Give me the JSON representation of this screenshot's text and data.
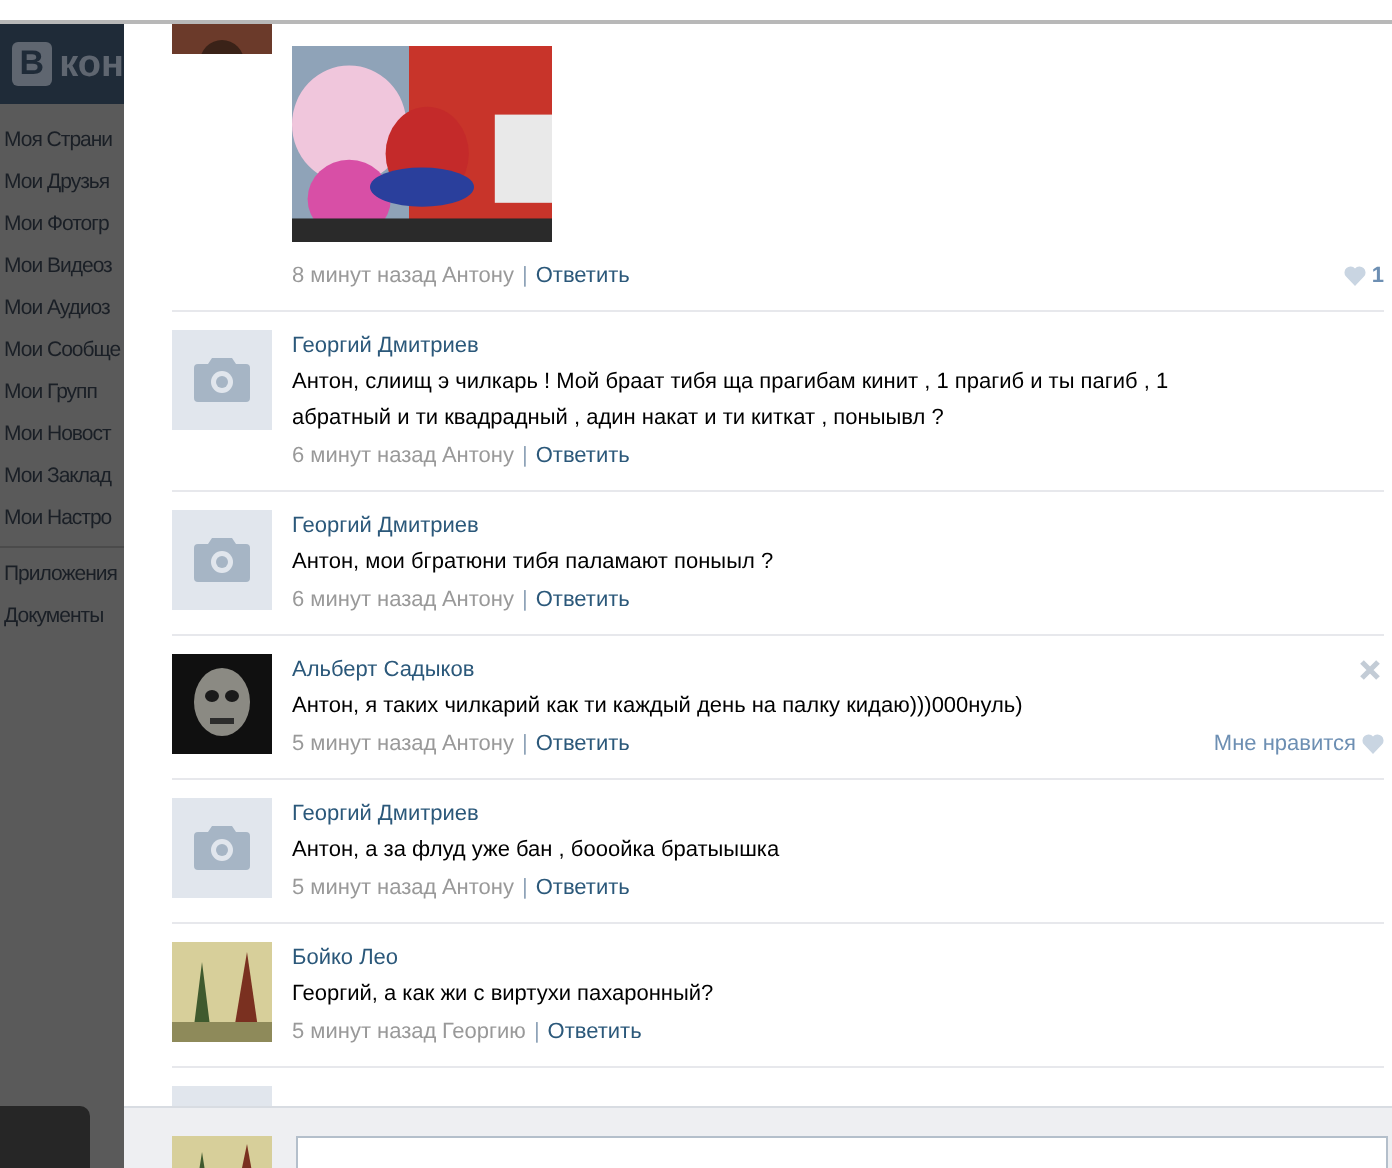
{
  "sidebar": {
    "logo_letter": "В",
    "logo_text": "кон",
    "items": [
      {
        "label": "Моя Страни"
      },
      {
        "label": "Мои Друзья"
      },
      {
        "label": "Мои Фотогр"
      },
      {
        "label": "Мои Видеоз"
      },
      {
        "label": "Мои Аудиоз"
      },
      {
        "label": "Мои Сообще"
      },
      {
        "label": "Мои Групп"
      },
      {
        "label": "Мои Новост"
      },
      {
        "label": "Мои Заклад"
      },
      {
        "label": "Мои Настро"
      }
    ],
    "extra_items": [
      {
        "label": "Приложения"
      },
      {
        "label": "Документы"
      }
    ]
  },
  "comments": [
    {
      "time": "8 минут назад",
      "reply_to": "Антону",
      "separator": "|",
      "reply_label": "Ответить",
      "likes": "1",
      "hovered": false
    },
    {
      "avatar": {
        "kind": "placeholder"
      },
      "author": "Георгий Дмитриев",
      "text": "Антон, слиищ э чилкарь ! Мой браат тибя ща прагибам кинит , 1 прагиб и ты пагиб , 1 абратный и ти квадрадный , адин накат и ти киткат , поныывл ?",
      "time": "6 минут назад",
      "reply_to": "Антону",
      "separator": "|",
      "reply_label": "Ответить",
      "hovered": false
    },
    {
      "avatar": {
        "kind": "placeholder"
      },
      "author": "Георгий Дмитриев",
      "text": "Антон, мои бгратюни тибя паламают поныыл ?",
      "time": "6 минут назад",
      "reply_to": "Антону",
      "separator": "|",
      "reply_label": "Ответить",
      "hovered": false
    },
    {
      "author": "Альберт Садыков",
      "text": "Антон, я таких чилкарий как ти каждый день на палку кидаю)))000нуль)",
      "time": "5 минут назад",
      "reply_to": "Антону",
      "separator": "|",
      "reply_label": "Ответить",
      "like_label": "Мне нравится",
      "hovered": true
    },
    {
      "avatar": {
        "kind": "placeholder"
      },
      "author": "Георгий Дмитриев",
      "text": "Антон, а за флуд уже бан , бооойка братыышка",
      "time": "5 минут назад",
      "reply_to": "Антону",
      "separator": "|",
      "reply_label": "Ответить",
      "hovered": false
    },
    {
      "author": "Бойко Лео",
      "text": "Георгий, а как жи с виртухи пахаронный?",
      "time": "5 минут назад",
      "reply_to": "Георгию",
      "separator": "|",
      "reply_label": "Ответить",
      "hovered": false
    },
    {
      "avatar": {
        "kind": "placeholder"
      }
    }
  ],
  "composer": {
    "focused": true
  }
}
